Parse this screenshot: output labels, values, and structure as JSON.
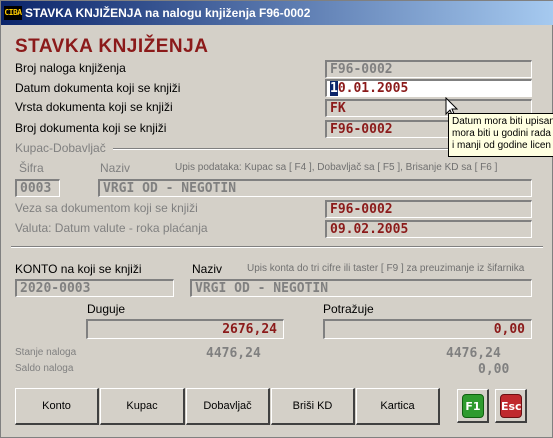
{
  "window": {
    "icon_text": "CIBA",
    "title": "STAVKA KNJIŽENJA na nalogu knjiženja F96-0002"
  },
  "heading": "STAVKA KNJIŽENJA",
  "fields": {
    "broj_naloga": {
      "label": "Broj naloga knjiženja",
      "value": "F96-0002"
    },
    "datum": {
      "label": "Datum dokumenta koji se knjiži",
      "value_first": "1",
      "value_rest": "0.01.2005"
    },
    "vrsta": {
      "label": "Vrsta dokumenta koji se knjiži",
      "value": "FK"
    },
    "broj_dok": {
      "label": "Broj dokumenta koji se knjiži",
      "value": "F96-0002"
    }
  },
  "kupac_group": {
    "title": "Kupac-Dobavljač",
    "sifra_label": "Šifra",
    "naziv_label": "Naziv",
    "hint": "Upis podataka:  Kupac sa [ F4 ],  Dobavljač sa [ F5 ],  Brisanje KD sa [ F6 ]",
    "sifra_value": "0003",
    "naziv_value": "VRGI OD - NEGOTIN",
    "veza_label": "Veza sa dokumentom koji se knjiži",
    "veza_value": "F96-0002",
    "valuta_label": "Valuta: Datum valute - roka plaćanja",
    "valuta_value": "09.02.2005"
  },
  "tooltip": {
    "line1": "Datum mora biti upisan",
    "line2": "mora biti u godini rada",
    "line3": "i manji od godine licen"
  },
  "konto": {
    "label": "KONTO na koji se knjiži",
    "naziv_label": "Naziv",
    "hint": "Upis konta do tri cifre ili taster [ F9 ] za preuzimanje iz šifarnika",
    "value": "2020-0003",
    "naziv_value": "VRGI OD - NEGOTIN"
  },
  "amounts": {
    "duguje_label": "Duguje",
    "potrazuje_label": "Potražuje",
    "duguje_value": "2676,24",
    "potrazuje_value": "0,00",
    "stanje_label": "Stanje naloga",
    "saldo_label": "Saldo naloga",
    "stanje_duguje": "4476,24",
    "stanje_potrazuje": "4476,24",
    "saldo_value": "0,00"
  },
  "buttons": {
    "konto": "Konto",
    "kupac": "Kupac",
    "dobavljac": "Dobavljač",
    "brisi_kd": "Briši KD",
    "kartica": "Kartica",
    "f1": "F1",
    "esc": "Esc"
  },
  "colors": {
    "accent_red": "#8b1a1a",
    "f1_green": "#2e9b2e",
    "esc_red": "#c0282d"
  }
}
